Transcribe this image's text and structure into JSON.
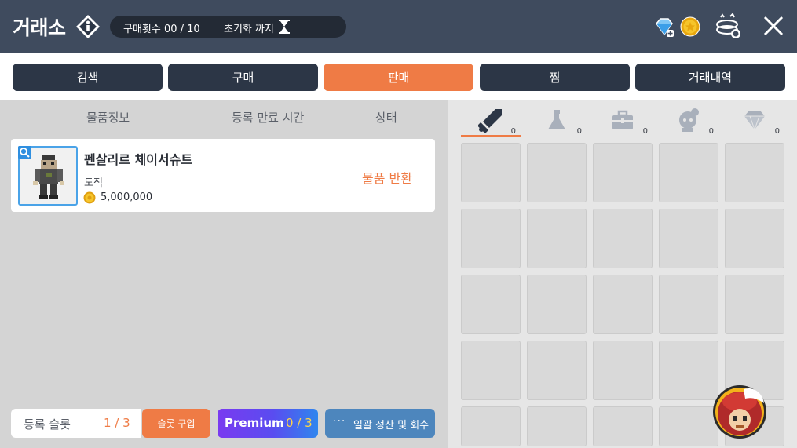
{
  "header": {
    "title": "거래소",
    "purchase_count": "구매횟수 00 / 10",
    "reset_label": "초기화 까지"
  },
  "tabs": [
    {
      "label": "검색",
      "active": false
    },
    {
      "label": "구매",
      "active": false
    },
    {
      "label": "판매",
      "active": true
    },
    {
      "label": "찜",
      "active": false
    },
    {
      "label": "거래내역",
      "active": false
    }
  ],
  "listing": {
    "columns": [
      "물품정보",
      "등록 만료 시간",
      "상태"
    ],
    "items": [
      {
        "name": "펜살리르 체이서슈트",
        "class": "도적",
        "price": "5,000,000",
        "status": "물품 반환"
      }
    ]
  },
  "footer": {
    "slot_label": "등록 슬롯",
    "slot_count": "1 / 3",
    "buy_slot_label": "슬롯 구입",
    "premium_label": "Premium",
    "premium_count": "0 / 3",
    "settle_dots": "···",
    "settle_label": "일괄 정산 및 회수"
  },
  "inventory": {
    "categories": [
      {
        "icon": "sword-icon",
        "count": "0",
        "active": true
      },
      {
        "icon": "potion-icon",
        "count": "0",
        "active": false
      },
      {
        "icon": "chest-icon",
        "count": "0",
        "active": false
      },
      {
        "icon": "character-icon",
        "count": "0",
        "active": false
      },
      {
        "icon": "diamond-icon",
        "count": "0",
        "active": false
      }
    ]
  },
  "colors": {
    "header_bg": "#3f4b5e",
    "tab_bg": "#2c3646",
    "accent": "#ef7b45",
    "premium_start": "#7a3af0",
    "premium_end": "#2f86ee",
    "settle_bg": "#4d86bd"
  }
}
